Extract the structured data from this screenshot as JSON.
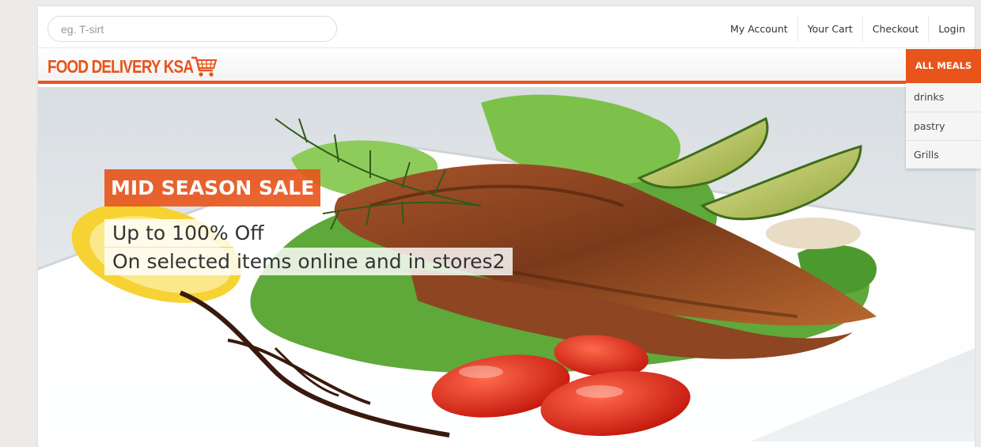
{
  "search": {
    "placeholder": "eg. T-sirt"
  },
  "top_nav": {
    "items": [
      {
        "label": "My Account"
      },
      {
        "label": "Your Cart"
      },
      {
        "label": "Checkout"
      },
      {
        "label": "Login"
      }
    ]
  },
  "brand": {
    "logo_text": "FOOD DELIVERY KSA",
    "icon": "shopping-cart-icon",
    "color": "#e8541a"
  },
  "menu": {
    "header": "ALL MEALS",
    "items": [
      {
        "label": "drinks"
      },
      {
        "label": "pastry"
      },
      {
        "label": "Grills"
      }
    ]
  },
  "hero": {
    "title": "MID SEASON SALE",
    "line1": "Up to 100% Off",
    "line2": "On selected items online and in stores2"
  },
  "colors": {
    "accent": "#e8541a",
    "background": "#ecebe9"
  }
}
